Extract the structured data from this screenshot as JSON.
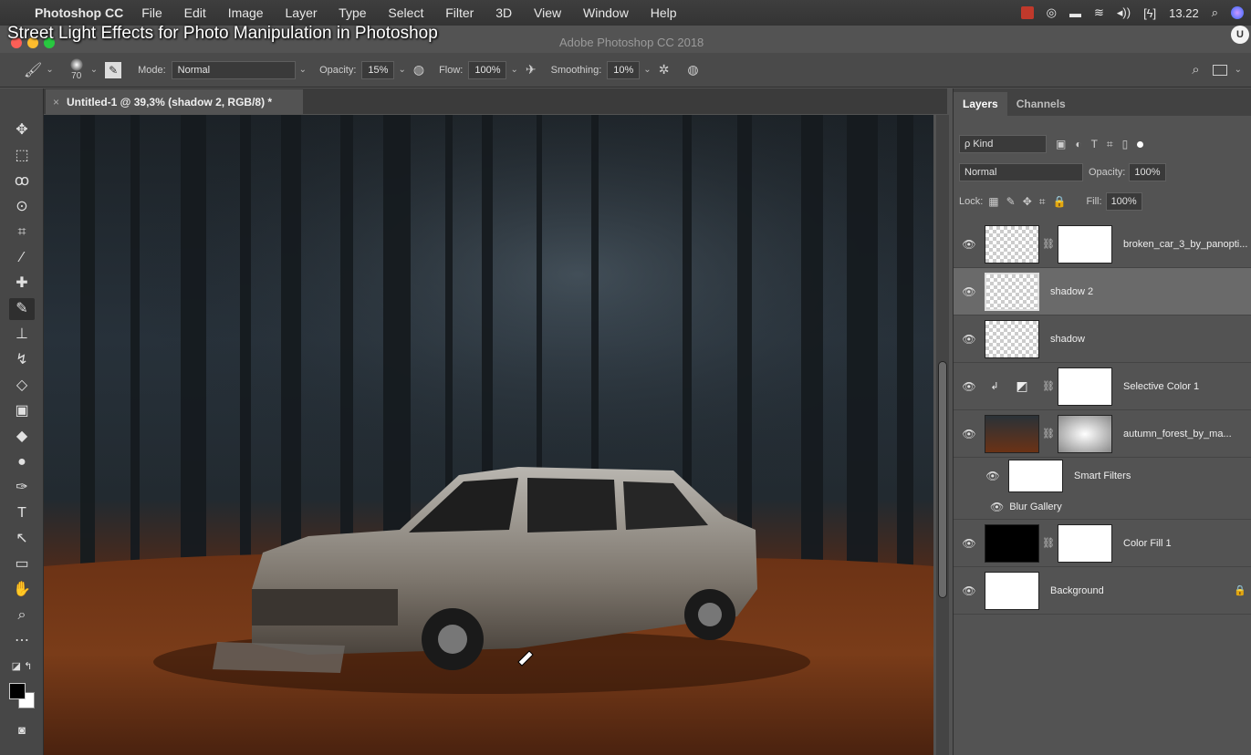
{
  "menubar": {
    "app": "Photoshop CC",
    "menus": [
      "File",
      "Edit",
      "Image",
      "Layer",
      "Type",
      "Select",
      "Filter",
      "3D",
      "View",
      "Window",
      "Help"
    ],
    "clock": "13.22",
    "battery_glyph": "[ϟ]"
  },
  "video_title": "Street Light Effects for Photo Manipulation in Photoshop",
  "window_title": "Adobe Photoshop CC 2018",
  "options": {
    "brush_size": "70",
    "mode_label": "Mode:",
    "mode_value": "Normal",
    "opacity_label": "Opacity:",
    "opacity_value": "15%",
    "flow_label": "Flow:",
    "flow_value": "100%",
    "smoothing_label": "Smoothing:",
    "smoothing_value": "10%"
  },
  "document_tab": "Untitled-1 @ 39,3% (shadow 2, RGB/8) *",
  "panel": {
    "tabs": [
      "Layers",
      "Channels"
    ],
    "filter_label": "ρ Kind",
    "blend_mode": "Normal",
    "opacity_label": "Opacity:",
    "opacity_value": "100%",
    "lock_label": "Lock:",
    "fill_label": "Fill:",
    "fill_value": "100%"
  },
  "layers": [
    {
      "name": "broken_car_3_by_panopti...",
      "selected": false
    },
    {
      "name": "shadow 2",
      "selected": true
    },
    {
      "name": "shadow",
      "selected": false
    },
    {
      "name": "Selective Color 1",
      "selected": false
    },
    {
      "name": "autumn_forest_by_ma...",
      "selected": false
    },
    {
      "name": "Smart Filters",
      "selected": false
    },
    {
      "name": "Blur Gallery",
      "selected": false
    },
    {
      "name": "Color Fill 1",
      "selected": false
    },
    {
      "name": "Background",
      "selected": false
    }
  ],
  "colors": {
    "accent_red": "#c0392b",
    "traffic_red": "#fc5f57",
    "traffic_yellow": "#fdbc2e",
    "traffic_green": "#28c840"
  }
}
